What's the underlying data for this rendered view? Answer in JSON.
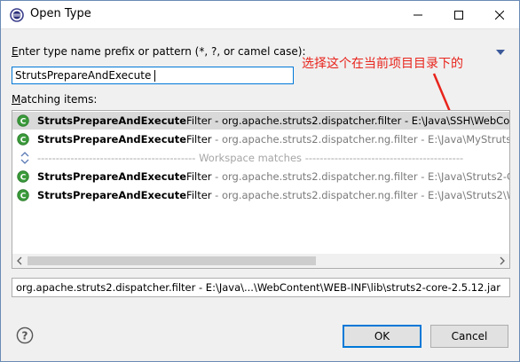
{
  "window": {
    "title": "Open Type"
  },
  "prompt": {
    "label_first": "E",
    "label_rest": "nter type name prefix or pattern (*, ?, or camel case):"
  },
  "search": {
    "value": "StrutsPrepareAndExecute"
  },
  "annotation": {
    "text": "选择这个在当前项目目录下的"
  },
  "matching": {
    "label_first": "M",
    "label_rest": "atching items:"
  },
  "items": [
    {
      "bold": "StrutsPrepareAndExecute",
      "rest": "Filter",
      "pkg": " - org.apache.struts2.dispatcher.filter - E:\\Java\\SSH\\WebCon"
    },
    {
      "bold": "StrutsPrepareAndExecute",
      "rest": "Filter",
      "pkg": " - org.apache.struts2.dispatcher.ng.filter - E:\\Java\\MyStruts2"
    },
    {
      "separator": "------------------------------------------- Workspace matches -------------------------------------------"
    },
    {
      "bold": "StrutsPrepareAndExecute",
      "rest": "Filter",
      "pkg": " - org.apache.struts2.dispatcher.ng.filter - E:\\Java\\Struts2-Co"
    },
    {
      "bold": "StrutsPrepareAndExecute",
      "rest": "Filter",
      "pkg": " - org.apache.struts2.dispatcher.ng.filter - E:\\Java\\Struts2\\W"
    }
  ],
  "status": {
    "text": "org.apache.struts2.dispatcher.filter - E:\\Java\\...\\WebContent\\WEB-INF\\lib\\struts2-core-2.5.12.jar"
  },
  "buttons": {
    "ok": "OK",
    "cancel": "Cancel"
  },
  "colors": {
    "accent": "#0078d7",
    "class_icon": "#3a9a3a",
    "annotation": "#e8241c"
  }
}
